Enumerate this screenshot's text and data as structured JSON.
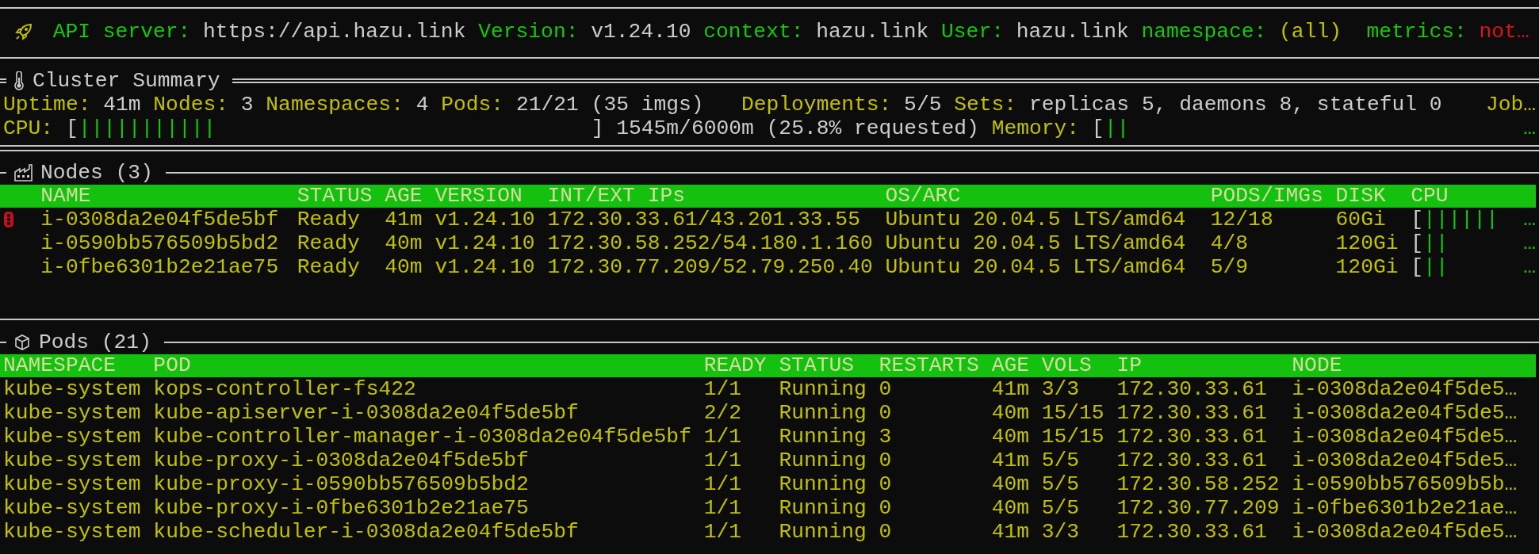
{
  "status_bar": {
    "items": [
      {
        "kind": "text",
        "label": "API server:",
        "value": "https://api.hazu.link"
      },
      {
        "kind": "text",
        "label": "Version:",
        "value": "v1.24.10"
      },
      {
        "kind": "text",
        "label": "context:",
        "value": "hazu.link"
      },
      {
        "kind": "text",
        "label": "User:",
        "value": "hazu.link"
      },
      {
        "kind": "scope",
        "label": "namespace:",
        "value": "(all)"
      },
      {
        "kind": "error",
        "label": "metrics:",
        "value": "not…"
      }
    ]
  },
  "cluster_summary": {
    "title": "Cluster Summary",
    "stat_groups": [
      [
        {
          "label": "Uptime:",
          "value": "41m"
        },
        {
          "label": "Nodes:",
          "value": "3"
        },
        {
          "label": "Namespaces:",
          "value": "4"
        },
        {
          "label": "Pods:",
          "value": "21/21 (35 imgs)"
        }
      ],
      [
        {
          "label": "Deployments:",
          "value": "5/5"
        },
        {
          "label": "Sets:",
          "value": "replicas 5, daemons 8, stateful 0"
        }
      ]
    ],
    "more": "Job…",
    "cpu": {
      "label": "CPU:",
      "open": "[",
      "bars": "|||||||||||",
      "close": "]",
      "usage": "1545m/6000m (25.8% requested)"
    },
    "memory": {
      "label": "Memory:",
      "open": "[",
      "bars": "||",
      "more": "…"
    }
  },
  "nodes": {
    "title": "Nodes (3)",
    "columns": [
      "NAME",
      "STATUS",
      "AGE",
      "VERSION",
      "INT/EXT IPs",
      "OS/ARC",
      "PODS/IMGs",
      "DISK",
      "CPU"
    ],
    "rows": [
      {
        "alert": true,
        "cells": [
          "i-0308da2e04f5de5bf",
          "Ready",
          "41m",
          "v1.24.10",
          "172.30.33.61/43.201.33.55",
          "Ubuntu 20.04.5 LTS/amd64",
          "12/18",
          "60Gi"
        ],
        "cpu_open": "[",
        "cpu_bars": "||||||",
        "more": "…"
      },
      {
        "alert": false,
        "cells": [
          "i-0590bb576509b5bd2",
          "Ready",
          "40m",
          "v1.24.10",
          "172.30.58.252/54.180.1.160",
          "Ubuntu 20.04.5 LTS/amd64",
          "4/8",
          "120Gi"
        ],
        "cpu_open": "[",
        "cpu_bars": "||",
        "more": "…"
      },
      {
        "alert": false,
        "cells": [
          "i-0fbe6301b2e21ae75",
          "Ready",
          "40m",
          "v1.24.10",
          "172.30.77.209/52.79.250.40",
          "Ubuntu 20.04.5 LTS/amd64",
          "5/9",
          "120Gi"
        ],
        "cpu_open": "[",
        "cpu_bars": "||",
        "more": "…"
      }
    ]
  },
  "pods": {
    "title": "Pods (21)",
    "columns": [
      "NAMESPACE",
      "POD",
      "READY",
      "STATUS",
      "RESTARTS",
      "AGE",
      "VOLS",
      "IP",
      "NODE"
    ],
    "rows": [
      [
        "kube-system",
        "kops-controller-fs422",
        "1/1",
        "Running",
        "0",
        "41m",
        "3/3",
        "172.30.33.61",
        "i-0308da2e04f5de5…"
      ],
      [
        "kube-system",
        "kube-apiserver-i-0308da2e04f5de5bf",
        "2/2",
        "Running",
        "0",
        "40m",
        "15/15",
        "172.30.33.61",
        "i-0308da2e04f5de5…"
      ],
      [
        "kube-system",
        "kube-controller-manager-i-0308da2e04f5de5bf",
        "1/1",
        "Running",
        "3",
        "40m",
        "15/15",
        "172.30.33.61",
        "i-0308da2e04f5de5…"
      ],
      [
        "kube-system",
        "kube-proxy-i-0308da2e04f5de5bf",
        "1/1",
        "Running",
        "0",
        "41m",
        "5/5",
        "172.30.33.61",
        "i-0308da2e04f5de5…"
      ],
      [
        "kube-system",
        "kube-proxy-i-0590bb576509b5bd2",
        "1/1",
        "Running",
        "0",
        "40m",
        "5/5",
        "172.30.58.252",
        "i-0590bb576509b5b…"
      ],
      [
        "kube-system",
        "kube-proxy-i-0fbe6301b2e21ae75",
        "1/1",
        "Running",
        "0",
        "40m",
        "5/5",
        "172.30.77.209",
        "i-0fbe6301b2e21ae…"
      ],
      [
        "kube-system",
        "kube-scheduler-i-0308da2e04f5de5bf",
        "1/1",
        "Running",
        "0",
        "41m",
        "3/3",
        "172.30.33.61",
        "i-0308da2e04f5de5…"
      ]
    ]
  }
}
